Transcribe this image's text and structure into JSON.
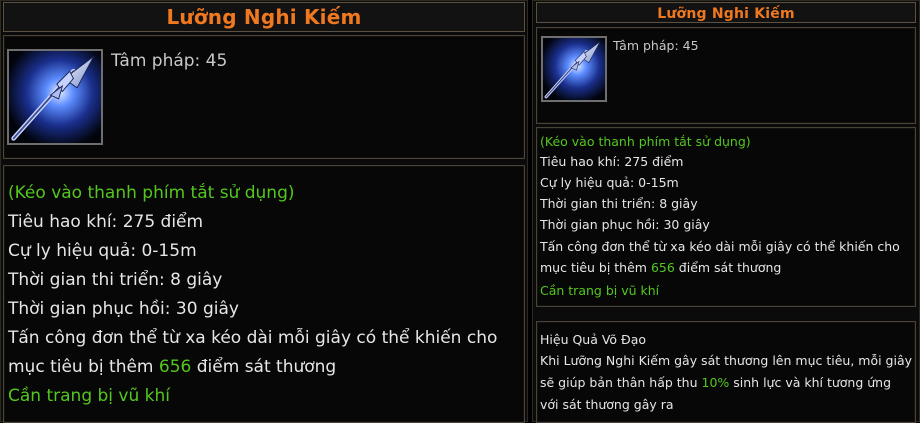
{
  "skill_name": "Lưỡng Nghi Kiếm",
  "stat_label": "Tâm pháp: 45",
  "hint": "(Kéo vào thanh phím tắt sử dụng)",
  "cost": "Tiêu hao khí: 275 điểm",
  "range": "Cự ly hiệu quả: 0-15m",
  "cast_time": " Thời gian thi triển: 8 giây",
  "cooldown": "Thời gian phục hồi: 30 giây",
  "effect_line1": "Tấn công đơn thể từ xa kéo dài mỗi giây có thể khiến cho",
  "effect_line2_pre": " mục tiêu bị thêm ",
  "effect_value": "656",
  "effect_line2_post": " điểm sát thương",
  "requirement": "Cần trang bị vũ khí",
  "martial": {
    "heading": "Hiệu Quả Võ Đạo",
    "line1": "Khi Lưỡng Nghi Kiếm gây sát thương lên mục tiêu, mỗi giây",
    "line2_pre": " sẽ giúp bản thân hấp thu ",
    "line2_value": "10%",
    "line2_post": " sinh lực và khí tương ứng",
    "line3": " với sát thương gây ra"
  },
  "icon_name": "spear-skill-icon",
  "colors": {
    "title": "#f0781e",
    "hint_green": "#54c71e",
    "text": "#e6e6e6"
  }
}
